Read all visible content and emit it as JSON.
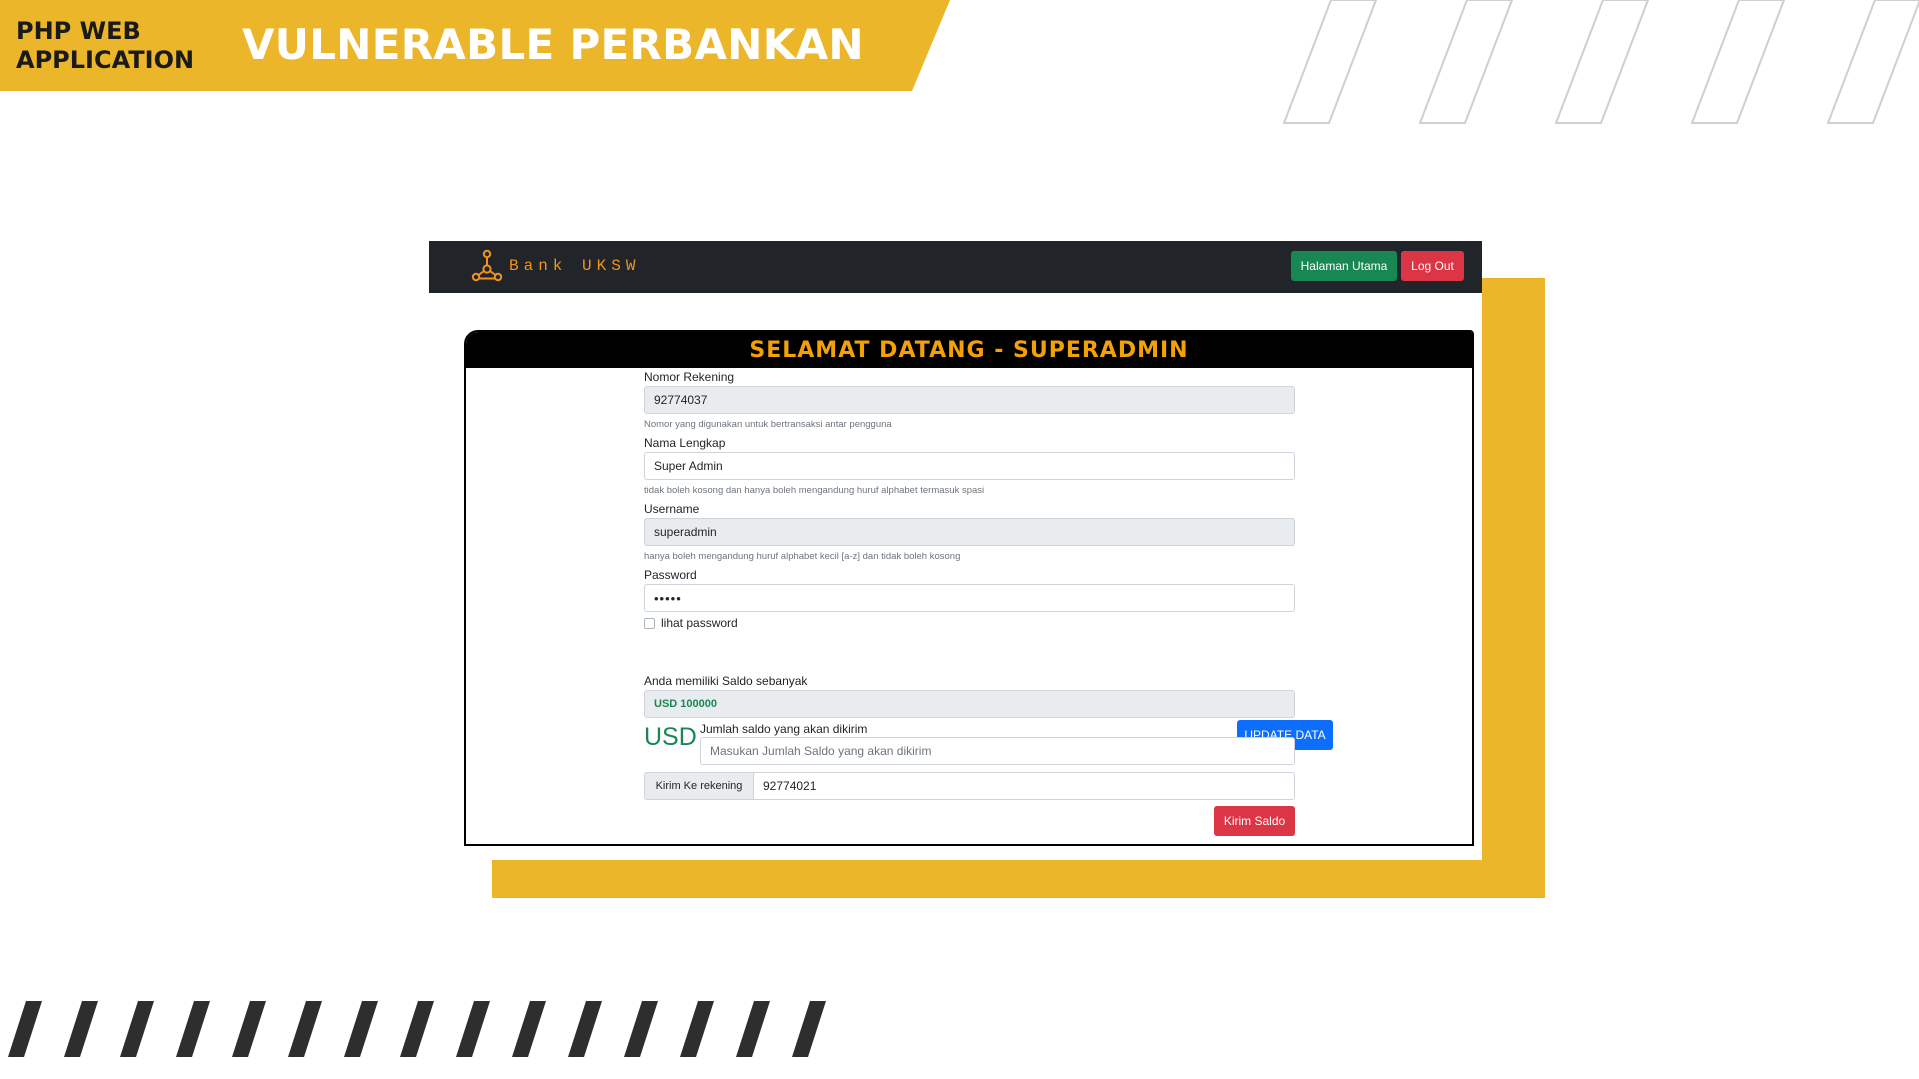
{
  "slide": {
    "title_small": "PHP WEB APPLICATION",
    "title_big": "VULNERABLE PERBANKAN",
    "accent_color": "#ecb62a"
  },
  "navbar": {
    "brand": "Bank UKSW",
    "brand_icon": "molecule-icon",
    "home_label": "Halaman Utama",
    "logout_label": "Log Out"
  },
  "card": {
    "header": "SELAMAT DATANG - SUPERADMIN"
  },
  "form": {
    "account_number": {
      "label": "Nomor Rekening",
      "value": "92774037",
      "help": "Nomor yang digunakan untuk bertransaksi antar pengguna"
    },
    "full_name": {
      "label": "Nama Lengkap",
      "value": "Super Admin",
      "help": "tidak boleh kosong dan hanya boleh mengandung huruf alphabet termasuk spasi"
    },
    "username": {
      "label": "Username",
      "value": "superadmin",
      "help": "hanya boleh mengandung huruf alphabet kecil [a-z] dan tidak boleh kosong"
    },
    "password": {
      "label": "Password",
      "value": "•••••",
      "show_label": "lihat password"
    },
    "update_label": "UPDATE DATA"
  },
  "balance": {
    "label": "Anda memiliki Saldo sebanyak",
    "value": "USD  100000"
  },
  "transfer": {
    "currency": "USD",
    "amount_label": "Jumlah saldo yang akan dikirim",
    "amount_placeholder": "Masukan Jumlah Saldo yang akan dikirim",
    "target_addon": "Kirim Ke rekening",
    "target_value": "92774021",
    "send_label": "Kirim Saldo"
  }
}
